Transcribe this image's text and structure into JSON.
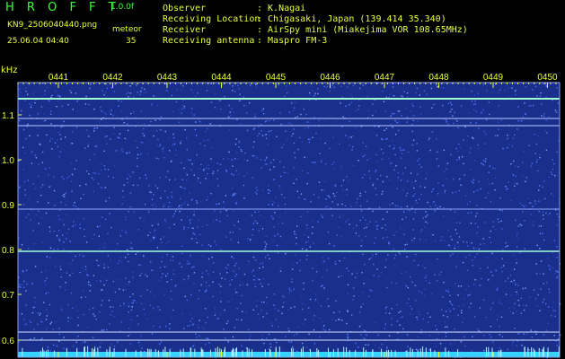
{
  "header": {
    "app_title": "H R O F F T",
    "version": "1.0.0f",
    "file_name": "KN9_2506040440.png",
    "timestamp": "25.06.04 04:40",
    "meteor_label": "meteor",
    "meteor_count": "35",
    "info": [
      {
        "key": "Observer",
        "value": ": K.Nagai"
      },
      {
        "key": "Receiving Location",
        "value": ": Chigasaki, Japan (139.414 35.340)"
      },
      {
        "key": "Receiver",
        "value": ": AirSpy mini (Miakejima VOR 108.65MHz)"
      },
      {
        "key": "Receiving antenna",
        "value": ": Maspro FM-3"
      }
    ]
  },
  "spectrogram": {
    "y_unit": "kHz",
    "y_ticks": [
      "1.1",
      "1.0",
      "0.9",
      "0.8",
      "0.7",
      "0.6"
    ],
    "x_ticks": [
      "0441",
      "0442",
      "0443",
      "0444",
      "0445",
      "0446",
      "0447",
      "0448",
      "0449",
      "0450"
    ],
    "colors": {
      "background": "#1a2f8c",
      "noise": "#5a7fff",
      "signal": "#9fffd0",
      "tick": "#e8ff3a",
      "baseline": "#33d4ff"
    }
  }
}
